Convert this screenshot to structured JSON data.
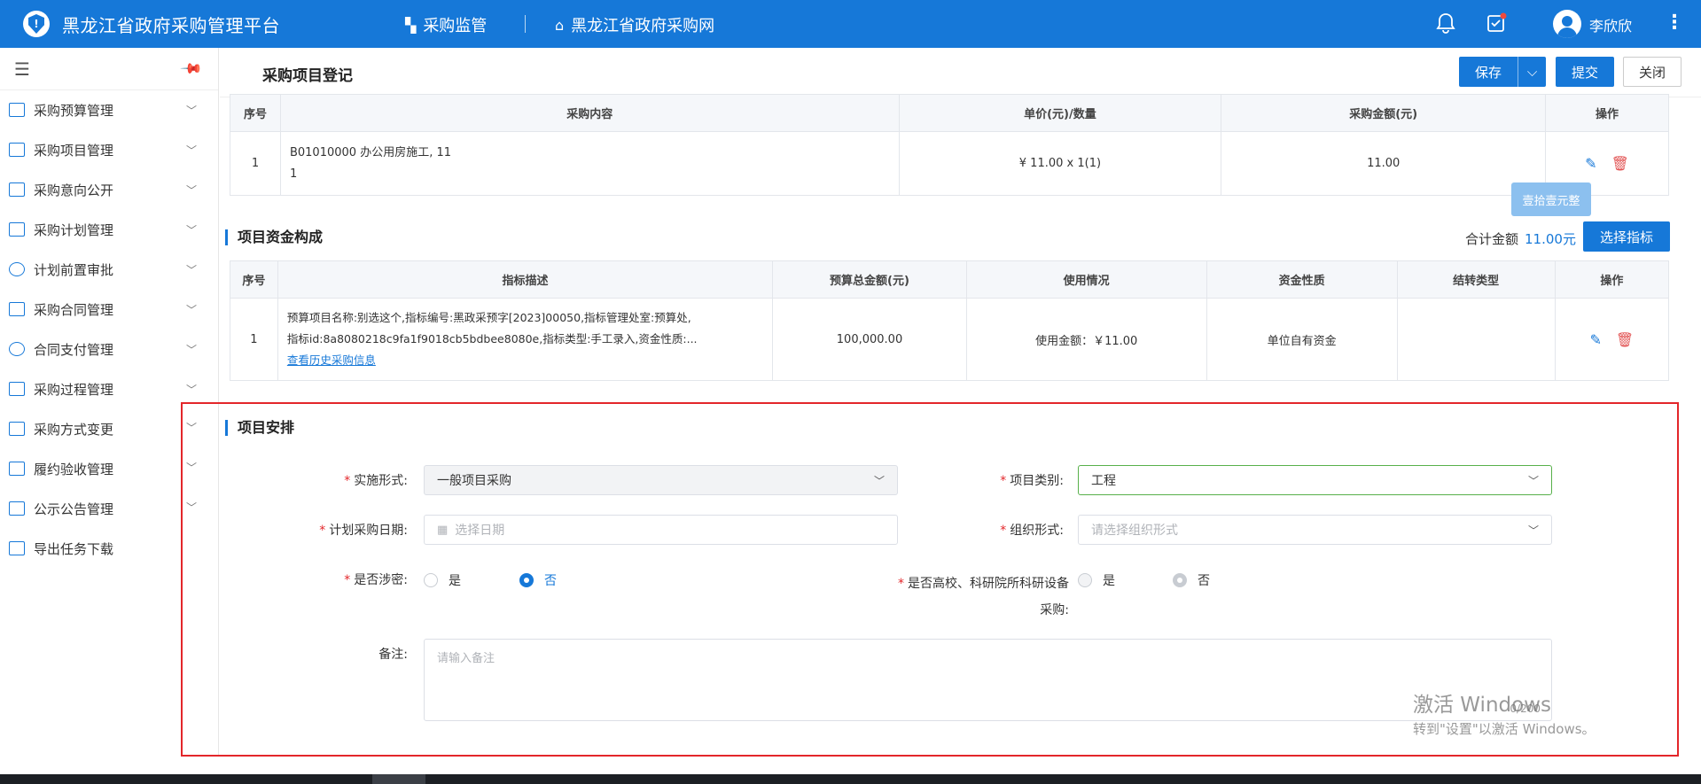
{
  "header": {
    "app_title": "黑龙江省政府采购管理平台",
    "nav": [
      {
        "label": "采购监管",
        "icon": "grid-icon"
      },
      {
        "label": "黑龙江省政府采购网",
        "icon": "home-icon"
      }
    ],
    "username": "李欣欣",
    "icons": [
      "bell-icon",
      "task-icon",
      "avatar-icon",
      "more-icon"
    ]
  },
  "sidebar": {
    "items": [
      {
        "label": "采购预算管理",
        "icon": "chart-icon"
      },
      {
        "label": "采购项目管理",
        "icon": "project-icon"
      },
      {
        "label": "采购意向公开",
        "icon": "document-icon"
      },
      {
        "label": "采购计划管理",
        "icon": "calendar-check-icon"
      },
      {
        "label": "计划前置审批",
        "icon": "stamp-icon"
      },
      {
        "label": "采购合同管理",
        "icon": "contract-icon"
      },
      {
        "label": "合同支付管理",
        "icon": "payment-icon"
      },
      {
        "label": "采购过程管理",
        "icon": "process-icon"
      },
      {
        "label": "采购方式变更",
        "icon": "change-icon"
      },
      {
        "label": "履约验收管理",
        "icon": "checklist-icon"
      },
      {
        "label": "公示公告管理",
        "icon": "notice-icon"
      },
      {
        "label": "导出任务下载",
        "icon": "export-icon"
      }
    ]
  },
  "page": {
    "title": "采购项目登记",
    "buttons": {
      "save": "保存",
      "submit": "提交",
      "close": "关闭"
    }
  },
  "items_table": {
    "headers": [
      "序号",
      "采购内容",
      "单价(元)/数量",
      "采购金额(元)",
      "操作"
    ],
    "rows": [
      {
        "index": "1",
        "content_line1": "B01010000 办公用房施工, 11",
        "content_line2": "1",
        "price_qty": "¥ 11.00 x 1(1)",
        "amount": "11.00"
      }
    ]
  },
  "tooltip": "壹拾壹元整",
  "funding": {
    "title": "项目资金构成",
    "total_label": "合计金额",
    "total_value": "11.00元",
    "select_button": "选择指标",
    "headers": [
      "序号",
      "指标描述",
      "预算总金额(元)",
      "使用情况",
      "资金性质",
      "结转类型",
      "操作"
    ],
    "rows": [
      {
        "index": "1",
        "desc_line1": "预算项目名称:别选这个,指标编号:黑政采预字[2023]00050,指标管理处室:预算处,",
        "desc_line2": "指标id:8a8080218c9fa1f9018cb5bdbee8080e,指标类型:手工录入,资金性质:...",
        "history_link": "查看历史采购信息",
        "budget_total": "100,000.00",
        "usage": "使用金额：￥11.00",
        "fund_nature": "单位自有资金",
        "carryover_type": ""
      }
    ]
  },
  "arrangement": {
    "title": "项目安排",
    "impl_form_label": "实施形式:",
    "impl_form_value": "一般项目采购",
    "category_label": "项目类别:",
    "category_value": "工程",
    "plan_date_label": "计划采购日期:",
    "plan_date_placeholder": "选择日期",
    "org_form_label": "组织形式:",
    "org_form_placeholder": "请选择组织形式",
    "secret_label": "是否涉密:",
    "secret_options": [
      "是",
      "否"
    ],
    "secret_selected": "否",
    "research_label_line1": "是否高校、科研院所科研设备",
    "research_label_line2": "采购:",
    "research_options": [
      "是",
      "否"
    ],
    "research_selected": "否",
    "remark_label": "备注:",
    "remark_placeholder": "请输入备注",
    "remark_counter": "0/200"
  },
  "watermark": {
    "line1": "激活 Windows",
    "line2": "转到\"设置\"以激活 Windows。"
  }
}
